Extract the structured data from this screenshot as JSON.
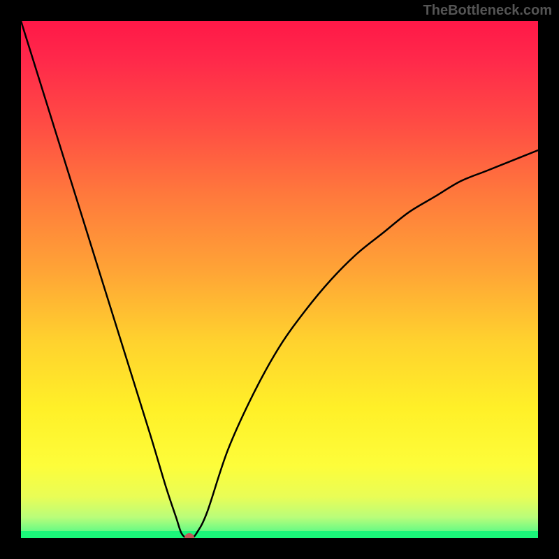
{
  "watermark": "TheBottleneck.com",
  "chart_data": {
    "type": "line",
    "title": "",
    "xlabel": "",
    "ylabel": "",
    "xlim": [
      0,
      100
    ],
    "ylim": [
      0,
      100
    ],
    "grid": false,
    "legend": false,
    "series": [
      {
        "name": "bottleneck-curve",
        "x": [
          0,
          5,
          10,
          15,
          20,
          25,
          28,
          30,
          31,
          32,
          33,
          34,
          36,
          40,
          45,
          50,
          55,
          60,
          65,
          70,
          75,
          80,
          85,
          90,
          95,
          100
        ],
        "values": [
          100,
          84,
          68,
          52,
          36,
          20,
          10,
          4,
          1,
          0,
          0,
          1,
          5,
          17,
          28,
          37,
          44,
          50,
          55,
          59,
          63,
          66,
          69,
          71,
          73,
          75
        ]
      }
    ],
    "minimum_point": {
      "x": 32.5,
      "y": 0
    },
    "background_gradient": {
      "top": "#ff1848",
      "middle": "#ffd22e",
      "bottom": "#1bf77a"
    }
  }
}
